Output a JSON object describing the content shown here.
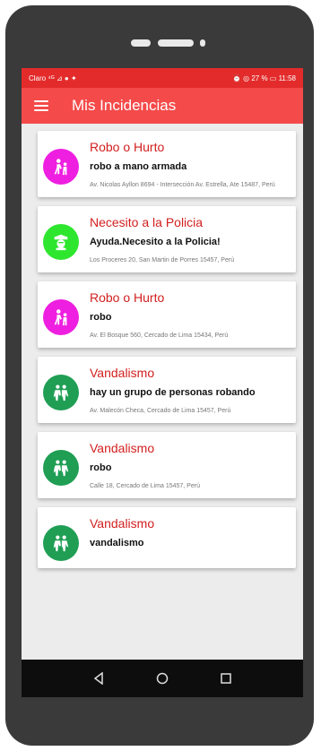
{
  "status": {
    "left": "Claro ﻿⁴ᴳ ⊿ ● ✦",
    "right": "⏰ ◎ 27 % ▭ 11:58"
  },
  "app": {
    "title": "Mis Incidencias"
  },
  "incidents": [
    {
      "category": "Robo o Hurto",
      "description": "robo a mano armada",
      "address": "Av. Nicolas Ayllon 8694 - Intersección Av. Estrella, Ate 15487, Perú",
      "color": "#ee1fe0"
    },
    {
      "category": "Necesito a la Policia",
      "description": "Ayuda.Necesito a la Policia!",
      "address": "Los Proceres 20, San Martin de Porres 15457, Perú",
      "color": "#2ee62e"
    },
    {
      "category": "Robo o Hurto",
      "description": "robo",
      "address": "Av. El Bosque 560, Cercado de Lima 15434, Perú",
      "color": "#ee1fe0"
    },
    {
      "category": "Vandalismo",
      "description": "hay un grupo de personas robando",
      "address": "Av. Malecón Checa, Cercado de Lima 15457, Perú",
      "color": "#1f9e54"
    },
    {
      "category": "Vandalismo",
      "description": "robo",
      "address": "Calle 18, Cercado de Lima 15457, Perú",
      "color": "#1f9e54"
    },
    {
      "category": "Vandalismo",
      "description": "vandalismo",
      "address": "",
      "color": "#1f9e54"
    }
  ]
}
